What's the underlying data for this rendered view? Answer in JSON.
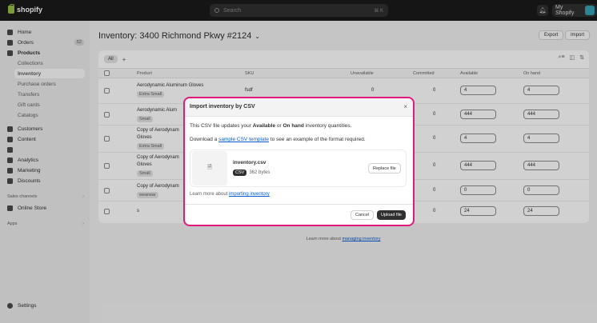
{
  "topbar": {
    "logo": "shopify",
    "search_placeholder": "Search",
    "search_shortcut": "⌘ K",
    "store_name": "My Shopify"
  },
  "sidebar": {
    "items": [
      {
        "label": "Home",
        "icon": "home-icon"
      },
      {
        "label": "Orders",
        "icon": "orders-icon",
        "badge": "52"
      },
      {
        "label": "Products",
        "icon": "products-icon"
      },
      {
        "label": "Collections"
      },
      {
        "label": "Inventory"
      },
      {
        "label": "Purchase orders"
      },
      {
        "label": "Transfers"
      },
      {
        "label": "Gift cards"
      },
      {
        "label": "Catalogs"
      },
      {
        "label": "Customers",
        "icon": "customers-icon"
      },
      {
        "label": "Content",
        "icon": "content-icon"
      },
      {
        "label": "Analytics",
        "icon": "analytics-icon"
      },
      {
        "label": "Marketing",
        "icon": "marketing-icon"
      },
      {
        "label": "Discounts",
        "icon": "discounts-icon"
      }
    ],
    "sales_channels_label": "Sales channels",
    "online_store": "Online Store",
    "apps_label": "Apps",
    "settings": "Settings"
  },
  "main": {
    "title": "Inventory: 3400 Richmond Pkwy #2124",
    "export": "Export",
    "import": "Import",
    "tab_all": "All",
    "columns": [
      "Product",
      "SKU",
      "Unavailable",
      "Committed",
      "Available",
      "On hand"
    ],
    "rows": [
      {
        "name": "Aerodynamic Aluminum Gloves",
        "variant": "Extra Small",
        "sku": "fsdf",
        "unavailable": "0",
        "committed": "0",
        "available": "4",
        "on_hand": "4"
      },
      {
        "name": "Aerodynamic Alum",
        "variant": "Small",
        "sku": "",
        "unavailable": "",
        "committed": "0",
        "available": "444",
        "on_hand": "444"
      },
      {
        "name": "Copy of Aerodynam",
        "name2": "Gloves",
        "variant": "Extra Small",
        "sku": "",
        "unavailable": "",
        "committed": "0",
        "available": "4",
        "on_hand": "4"
      },
      {
        "name": "Copy of Aerodynam",
        "name2": "Gloves",
        "variant": "Small",
        "sku": "",
        "unavailable": "",
        "committed": "0",
        "available": "444",
        "on_hand": "444"
      },
      {
        "name": "Copy of Aerodynam",
        "variant": "wearwar",
        "sku": "",
        "unavailable": "",
        "committed": "0",
        "available": "0",
        "on_hand": "0"
      },
      {
        "name": "s",
        "variant": "",
        "sku": "",
        "unavailable": "",
        "committed": "0",
        "available": "24",
        "on_hand": "24"
      }
    ],
    "footer_prefix": "Learn more about ",
    "footer_link": "managing inventory"
  },
  "modal": {
    "title": "Import inventory by CSV",
    "line1_prefix": "This CSV file updates your ",
    "line1_available": "Available",
    "line1_or": " or ",
    "line1_onhand": "On hand",
    "line1_suffix": " inventory quantities.",
    "line2_prefix": "Download a ",
    "line2_link": "sample CSV template",
    "line2_suffix": " to see an example of the format required.",
    "file_name": "inventory.csv",
    "file_type": "CSV",
    "file_size": "362 bytes",
    "replace": "Replace file",
    "learn_prefix": "Learn more about ",
    "learn_link": "importing inventory",
    "cancel": "Cancel",
    "upload": "Upload file",
    "accent_color": "#e0197d"
  }
}
